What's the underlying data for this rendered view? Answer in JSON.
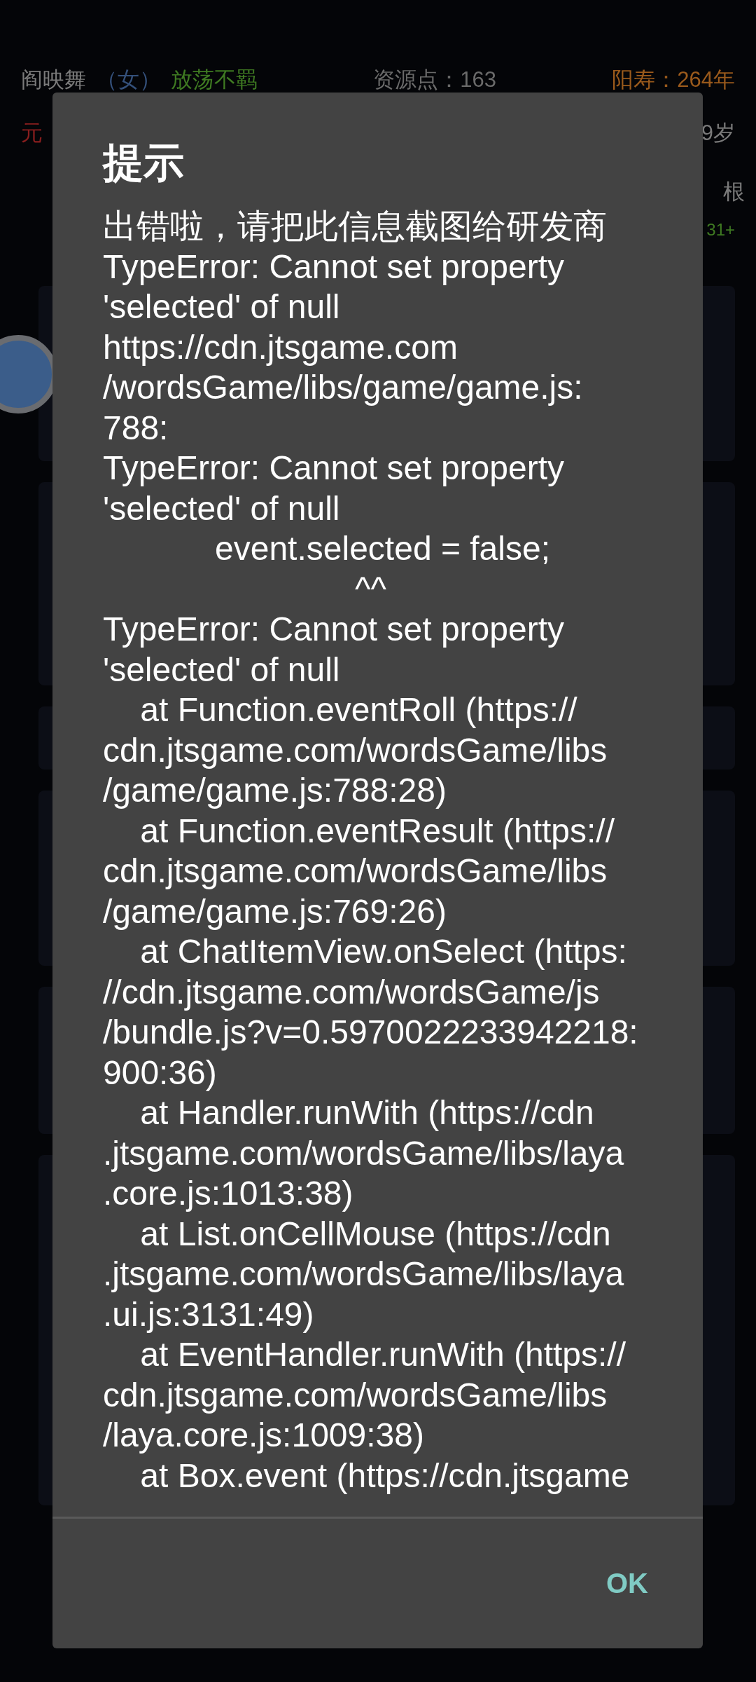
{
  "background": {
    "header": {
      "name": "阎映舞",
      "gender": "（女）",
      "trait": "放荡不羁",
      "resources": "资源点：163",
      "lifespan": "阳寿：264年",
      "realm": "元",
      "age": "9岁",
      "stat_label": "根",
      "stat_value": "31+"
    }
  },
  "dialog": {
    "title": "提示",
    "message": "出错啦，请把此信息截图给研发商\nTypeError: Cannot set property\n'selected' of null\nhttps://cdn.jtsgame.com\n/wordsGame/libs/game/game.js:\n788:\nTypeError: Cannot set property\n'selected' of null\n            event.selected = false;\n                           ^^\nTypeError: Cannot set property\n'selected' of null\n    at Function.eventRoll (https://\ncdn.jtsgame.com/wordsGame/libs\n/game/game.js:788:28)\n    at Function.eventResult (https://\ncdn.jtsgame.com/wordsGame/libs\n/game/game.js:769:26)\n    at ChatItemView.onSelect (https:\n//cdn.jtsgame.com/wordsGame/js\n/bundle.js?v=0.5970022233942218:\n900:36)\n    at Handler.runWith (https://cdn\n.jtsgame.com/wordsGame/libs/laya\n.core.js:1013:38)\n    at List.onCellMouse (https://cdn\n.jtsgame.com/wordsGame/libs/laya\n.ui.js:3131:49)\n    at EventHandler.runWith (https://\ncdn.jtsgame.com/wordsGame/libs\n/laya.core.js:1009:38)\n    at Box.event (https://cdn.jtsgame",
    "button": "OK"
  }
}
